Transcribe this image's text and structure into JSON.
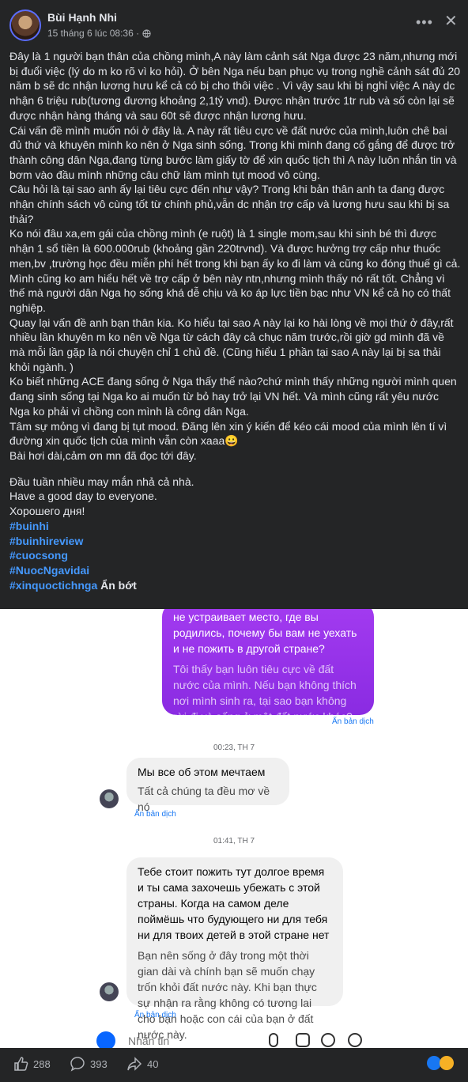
{
  "post": {
    "author": "Bùi Hạnh Nhi",
    "time": "15 tháng 6 lúc 08:36 ·",
    "paragraphs": [
      "Đây là 1 người bạn thân của chồng mình,A này làm cảnh sát Nga được 23 năm,nhưng mới bị đuổi việc (lý do m ko rõ vì ko hỏi). Ở bên Nga nếu bạn phục vụ trong nghề cảnh sát đủ 20 năm b sẽ dc nhận lương hưu kể cả có bị cho thôi việc . Vì vậy sau khi bị nghỉ việc A này dc nhận  6 triệu rub(tương đương khoảng 2,1tỷ vnd). Được nhận trước 1tr rub và số còn lại sẽ được nhận hàng tháng và sau 60t sẽ được nhận lương hưu.",
      "Cái vấn đề mình muốn nói ở đây là. A này rất tiêu cực về đất nước của mình,luôn chê bai đủ thứ và khuyên mình ko nên ở Nga sinh sống. Trong khi mình đang cố gắng để được trở thành công dân Nga,đang từng bước làm giấy tờ để xin quốc tịch thì A này luôn nhắn tin và bơm vào đầu mình những câu chữ làm mình tụt mood vô cùng.",
      "Câu hỏi là tại sao anh ấy lại tiêu cực đến như vậy? Trong khi bản thân anh ta đang được nhận chính sách vô cùng tốt từ chính phủ,vẫn dc nhận trợ cấp và lương hưu sau khi bị sa thải?",
      "Ko nói đâu xa,em gái của chồng mình (e ruột) là 1 single mom,sau khi sinh bé thì được nhận 1 sổ tiền là 600.000rub (khoảng gần 220trvnd). Và được hưởng trợ cấp như thuốc men,bv ,trường học đều miễn phí hết trong khi bạn ấy ko đi làm và cũng ko đóng thuế gì cả.",
      "Mình cũng ko am hiểu hết về trợ cấp ở bên này ntn,nhưng mình thấy nó rất tốt. Chẳng vì thế mà người dân Nga họ sống khá dễ chịu và ko áp lực tiền bạc như VN kể cả họ có thất nghiệp.",
      "Quay lại vấn đề anh bạn thân kia. Ko hiểu tại sao A này lại ko hài lòng về mọi thứ ở đây,rất nhiều lần khuyên m ko nên về Nga từ cách đây cả chục năm trước,rồi giờ gd mình đã về mà mỗi lần gặp là nói chuyện chỉ 1 chủ đề. (Cũng hiểu 1 phần tại sao A này lại bị sa thải khỏi ngành. )",
      "Ko biết những ACE đang sống ở Nga thấy thế nào?chứ mình thấy những người mình quen đang sinh sống tại Nga ko ai muốn từ bỏ hay trở lại VN hết. Và mình cũng rất yêu nước Nga ko phải vì chồng con mình là công dân Nga.",
      "Tâm sự mỏng vì đang bị tụt mood. Đăng lên xin ý kiến để kéo cái mood của mình lên tí vì đường xin quốc tịch của mình vẫn còn xaaa😀",
      "Bài hơi dài,cảm ơn mn đã đọc tới đây."
    ],
    "closing": [
      "Đầu tuần nhiều may mắn nhả cả nhà.",
      "Have a good day to everyone.",
      "Хорошего дня!"
    ],
    "hashtags": [
      "#buinhi",
      "#buinhireview",
      "#cuocsong",
      "#NuocNgavidai",
      "#xinquoctichnga"
    ],
    "see_more": "Ẩn bớt"
  },
  "chat": {
    "msg1_ru": "не устраивает место, где вы родились, почему бы вам не уехать и не пожить в другой стране?",
    "msg1_vi": "Tôi thấy bạn luôn tiêu cực về đất nước của mình. Nếu bạn không thích nơi mình sinh ra, tại sao bạn không rời đi và sống ở một đất nước khác?",
    "translate_label": "Ẩn bản dịch",
    "ts1": "00:23, TH 7",
    "msg2_ru": "Мы все об этом мечтаем",
    "msg2_vi": "Tất cả chúng ta đều mơ về nó",
    "ts2": "01:41, TH 7",
    "msg3_ru": "Тебе стоит пожить тут долгое время и ты сама захочешь убежать с этой страны. Когда на самом деле поймёшь что будующего ни для тебя ни для твоих детей в этой  стране нет",
    "msg3_vi": "Bạn nên sống ở đây trong một thời gian dài và chính bạn sẽ muốn chạy trốn khỏi đất nước này. Khi bạn thực sự nhận ra rằng không có tương lai cho bạn hoặc con cái của bạn ở đất nước này.",
    "compose_placeholder": "Nhắn tin"
  },
  "reactions": {
    "likes": "288",
    "comments": "393",
    "shares": "40"
  }
}
